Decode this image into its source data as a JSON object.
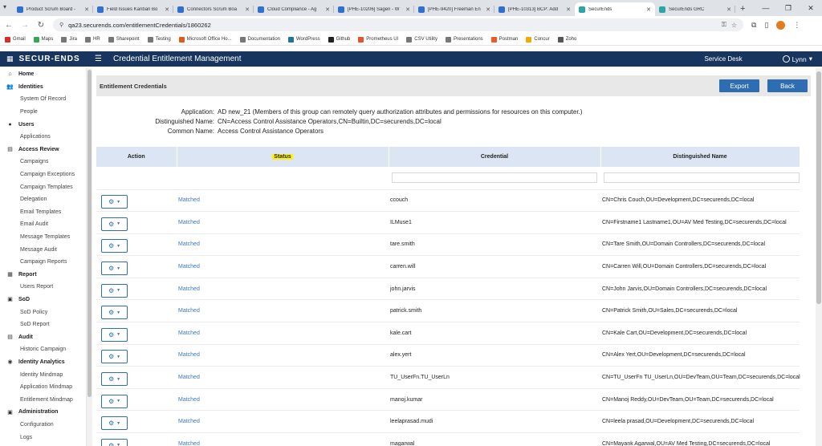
{
  "browser": {
    "tabs": [
      {
        "label": "Product Scrum Board -",
        "color": "#2f6fd1"
      },
      {
        "label": "Field Issues Kanban Bo",
        "color": "#2f6fd1"
      },
      {
        "label": "Connectors Scrum Boa",
        "color": "#2f6fd1"
      },
      {
        "label": "Cloud Compliance - Ag",
        "color": "#2f6fd1"
      },
      {
        "label": "[PHE-10206] Sagen - W",
        "color": "#2f6fd1"
      },
      {
        "label": "[PHE-9420] Freeman En",
        "color": "#2f6fd1"
      },
      {
        "label": "[PHE-10313] BCP: Add",
        "color": "#2f6fd1"
      },
      {
        "label": "SecurEnds",
        "color": "#2aa6a6"
      },
      {
        "label": "SecurEnds GRC",
        "color": "#2aa6a6"
      }
    ],
    "active_tab": 7,
    "url": "qa23.securends.com/entitlementCredentials/1860262",
    "bookmarks": [
      {
        "label": "Gmail",
        "color": "#d93025"
      },
      {
        "label": "Maps",
        "color": "#34a853"
      },
      {
        "label": "Jira",
        "color": "#777"
      },
      {
        "label": "HR",
        "color": "#777"
      },
      {
        "label": "Sharepoint",
        "color": "#777"
      },
      {
        "label": "Testing",
        "color": "#777"
      },
      {
        "label": "Microsoft Office Ho...",
        "color": "#e05a1c"
      },
      {
        "label": "Documentation",
        "color": "#777"
      },
      {
        "label": "WordPress",
        "color": "#21759b"
      },
      {
        "label": "Github",
        "color": "#222"
      },
      {
        "label": "Prometheus UI",
        "color": "#e6522c"
      },
      {
        "label": "CSV Utility",
        "color": "#777"
      },
      {
        "label": "Presentations",
        "color": "#777"
      },
      {
        "label": "Postman",
        "color": "#ef5b25"
      },
      {
        "label": "Concur",
        "color": "#f2a900"
      },
      {
        "label": "Zoho",
        "color": "#555"
      }
    ]
  },
  "app": {
    "logo": "SECUR-ENDS",
    "title": "Credential Entitlement Management",
    "service_desk": "Service Desk",
    "user": "Lynn"
  },
  "sidebar": [
    {
      "label": "Home",
      "type": "section",
      "icon": "home-icon"
    },
    {
      "label": "Identities",
      "type": "section",
      "icon": "people-icon"
    },
    {
      "label": "System Of Record",
      "type": "sub"
    },
    {
      "label": "People",
      "type": "sub"
    },
    {
      "label": "Users",
      "type": "section",
      "icon": "user-icon"
    },
    {
      "label": "Applications",
      "type": "sub"
    },
    {
      "label": "Access Review",
      "type": "section",
      "icon": "review-icon"
    },
    {
      "label": "Campaigns",
      "type": "sub"
    },
    {
      "label": "Campaign Exceptions",
      "type": "sub"
    },
    {
      "label": "Campaign Templates",
      "type": "sub"
    },
    {
      "label": "Delegation",
      "type": "sub"
    },
    {
      "label": "Email Templates",
      "type": "sub"
    },
    {
      "label": "Email Audit",
      "type": "sub"
    },
    {
      "label": "Message Templates",
      "type": "sub"
    },
    {
      "label": "Message Audit",
      "type": "sub"
    },
    {
      "label": "Campaign Reports",
      "type": "sub"
    },
    {
      "label": "Report",
      "type": "section",
      "icon": "report-icon"
    },
    {
      "label": "Users Report",
      "type": "sub"
    },
    {
      "label": "SoD",
      "type": "section",
      "icon": "sod-icon"
    },
    {
      "label": "SoD Policy",
      "type": "sub"
    },
    {
      "label": "SoD Report",
      "type": "sub"
    },
    {
      "label": "Audit",
      "type": "section",
      "icon": "audit-icon"
    },
    {
      "label": "Historic Campaign",
      "type": "sub"
    },
    {
      "label": "Identity Analytics",
      "type": "section",
      "icon": "analytics-icon"
    },
    {
      "label": "Identity Mindmap",
      "type": "sub"
    },
    {
      "label": "Application Mindmap",
      "type": "sub"
    },
    {
      "label": "Entitlement Mindmap",
      "type": "sub"
    },
    {
      "label": "Administration",
      "type": "section",
      "icon": "admin-icon"
    },
    {
      "label": "Configuration",
      "type": "sub"
    },
    {
      "label": "Logs",
      "type": "sub"
    }
  ],
  "page": {
    "title": "Entitlement Credentials",
    "export_label": "Export",
    "back_label": "Back"
  },
  "info": {
    "application_label": "Application:",
    "application_value": "AD new_21 (Members of this group can remotely query authorization attributes and permissions for resources on this computer.)",
    "dn_label": "Distinguished Name:",
    "dn_value": "CN=Access Control Assistance Operators,CN=Builtin,DC=securends,DC=local",
    "cn_label": "Common Name:",
    "cn_value": "Access Control Assistance Operators"
  },
  "table": {
    "columns": [
      "Action",
      "Status",
      "Credential",
      "Distinguished Name"
    ],
    "rows": [
      {
        "status": "Matched",
        "credential": "ccouch",
        "dn": "CN=Chris Couch,OU=Development,DC=securends,DC=local"
      },
      {
        "status": "Matched",
        "credential": "ILMuse1",
        "dn": "CN=Firstname1 Lastname1,OU=AV Med Testing,DC=securends,DC=local"
      },
      {
        "status": "Matched",
        "credential": "tare.smith",
        "dn": "CN=Tare Smith,OU=Domain Controllers,DC=securends,DC=local"
      },
      {
        "status": "Matched",
        "credential": "carren.will",
        "dn": "CN=Carren Will,OU=Domain Controllers,DC=securends,DC=local"
      },
      {
        "status": "Matched",
        "credential": "john.jarvis",
        "dn": "CN=John Jarvis,OU=Domain Controllers,DC=securends,DC=local"
      },
      {
        "status": "Matched",
        "credential": "patrick.smith",
        "dn": "CN=Patrick Smith,OU=Sales,DC=securends,DC=local"
      },
      {
        "status": "Matched",
        "credential": "kale.cart",
        "dn": "CN=Kale Cart,OU=Development,DC=securends,DC=local"
      },
      {
        "status": "Matched",
        "credential": "alex.yert",
        "dn": "CN=Alex Yert,OU=Development,DC=securends,DC=local"
      },
      {
        "status": "Matched",
        "credential": "TU_UserFn.TU_UserLn",
        "dn": "CN=TU_UserFn TU_UserLn,OU=DevTeam,OU=Team,DC=securends,DC=local"
      },
      {
        "status": "Matched",
        "credential": "manoj.kumar",
        "dn": "CN=Manoj Reddy,OU=DevTeam,OU=Team,DC=securends,DC=local"
      },
      {
        "status": "Matched",
        "credential": "leelaprasad.mudi",
        "dn": "CN=leela prasad,OU=Development,DC=securends,DC=local"
      },
      {
        "status": "Matched",
        "credential": "magarwal",
        "dn": "CN=Mayank Agarwal,OU=AV Med Testing,DC=securends,DC=local"
      }
    ]
  }
}
